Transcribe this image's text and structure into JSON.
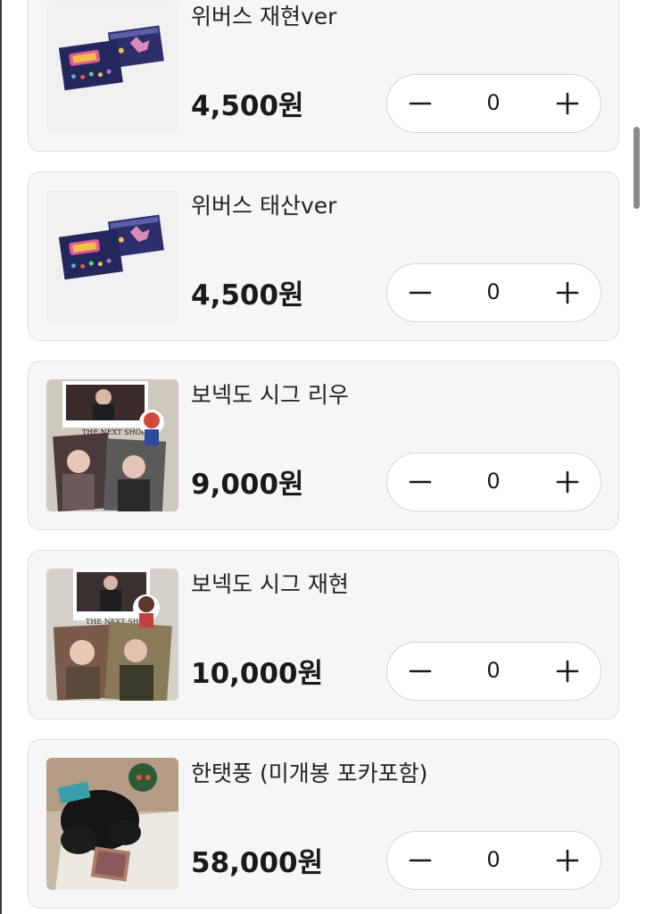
{
  "products": [
    {
      "name": "위버스 재현ver",
      "price": "4,500원",
      "quantity": "0",
      "image": "weverse-card-set-image"
    },
    {
      "name": "위버스 태산ver",
      "price": "4,500원",
      "quantity": "0",
      "image": "weverse-card-set-image"
    },
    {
      "name": "보넥도 시그 리우",
      "price": "9,000원",
      "quantity": "0",
      "image": "season-greeting-photo-set-image"
    },
    {
      "name": "보넥도 시그 재현",
      "price": "10,000원",
      "quantity": "0",
      "image": "season-greeting-photo-set-image"
    },
    {
      "name": "한탯풍 (미개봉 포카포함)",
      "price": "58,000원",
      "quantity": "0",
      "image": "plush-doll-image"
    }
  ],
  "icons": {
    "decrease": "minus-icon",
    "increase": "plus-icon"
  },
  "colors": {
    "card_background": "#f6f6f6",
    "card_border": "#dedede",
    "stepper_background": "#ffffff",
    "text": "#1a1a1a"
  }
}
